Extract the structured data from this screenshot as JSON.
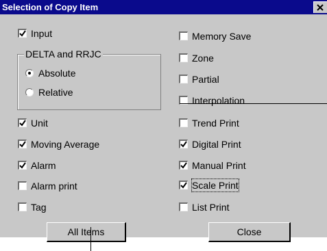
{
  "window": {
    "title": "Selection of Copy Item"
  },
  "left_items": [
    {
      "label": "Input",
      "checked": true
    },
    {
      "label": "Unit",
      "checked": true
    },
    {
      "label": "Moving Average",
      "checked": true
    },
    {
      "label": "Alarm",
      "checked": true
    },
    {
      "label": "Alarm print",
      "checked": false
    },
    {
      "label": "Tag",
      "checked": false
    }
  ],
  "group": {
    "label": "DELTA and RRJC",
    "options": [
      {
        "label": "Absolute",
        "selected": true
      },
      {
        "label": "Relative",
        "selected": false
      }
    ]
  },
  "right_items": [
    {
      "label": "Memory Save",
      "checked": false
    },
    {
      "label": "Zone",
      "checked": false
    },
    {
      "label": "Partial",
      "checked": false
    },
    {
      "label": "Interpolation",
      "checked": false
    },
    {
      "label": "Trend Print",
      "checked": false
    },
    {
      "label": "Digital Print",
      "checked": true
    },
    {
      "label": "Manual Print",
      "checked": true
    },
    {
      "label": "Scale Print",
      "checked": true
    },
    {
      "label": "List Print",
      "checked": false
    }
  ],
  "buttons": {
    "all_items": "All Items",
    "close": "Close"
  },
  "icons": {
    "close": "close-icon",
    "check": "checkmark-icon"
  }
}
